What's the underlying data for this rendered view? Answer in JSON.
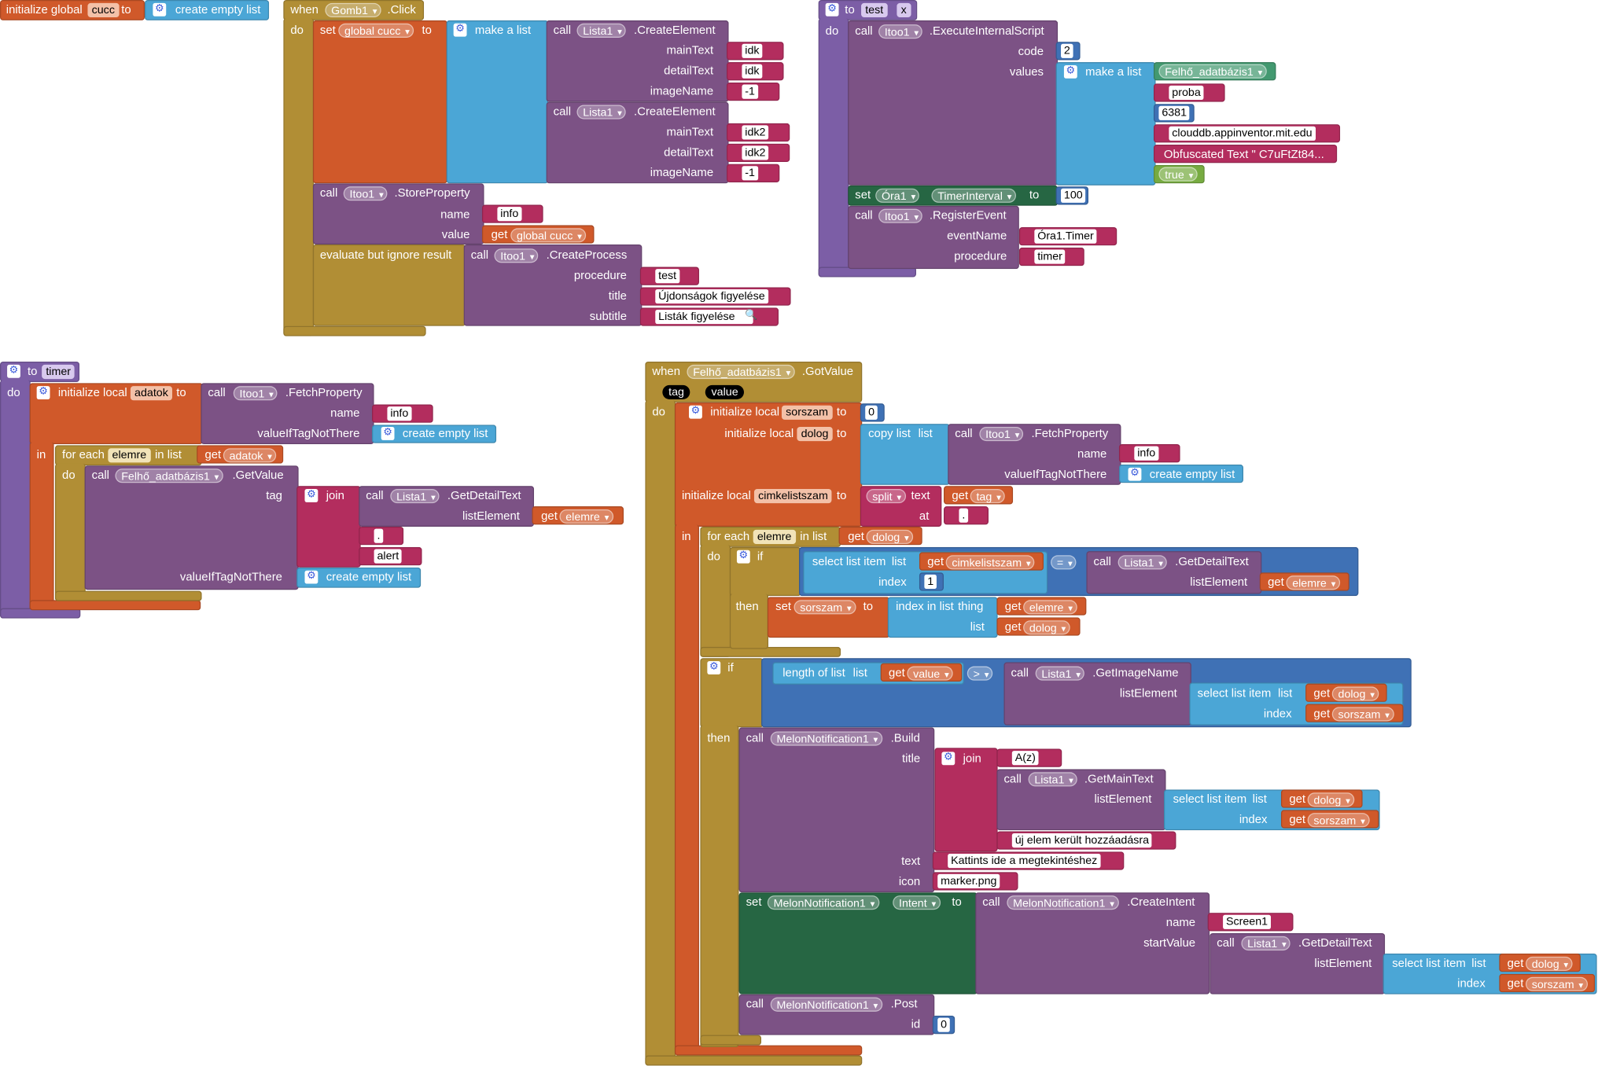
{
  "colors": {
    "variable": "#d0592a",
    "list": "#4ba6d6",
    "component": "#7c5285",
    "event": "#b18e35",
    "text": "#b32d5e",
    "math": "#3f71b5",
    "logic": "#77ab41",
    "setter": "#266643",
    "db": "#439970",
    "procedure": "#7c5ea6"
  },
  "kw": {
    "initialize_global": "initialize global",
    "initialize_local": "initialize local",
    "to": "to",
    "when": "when",
    "do": "do",
    "in": "in",
    "then": "then",
    "if": "if",
    "set": "set",
    "get": "get",
    "call": "call",
    "list": "list",
    "index": "index",
    "text": "text",
    "at": "at",
    "name": "name",
    "value": "value",
    "tag": "tag",
    "thing": "thing",
    "join": "join",
    "icon": "icon",
    "title": "title",
    "subtitle": "subtitle",
    "procedure": "procedure",
    "code": "code",
    "values": "values",
    "id": "id",
    "mainText": "mainText",
    "detailText": "detailText",
    "imageName": "imageName",
    "listElement": "listElement",
    "startValue": "startValue",
    "eventName": "eventName",
    "valueIfTagNotThere": "valueIfTagNotThere",
    "make_a_list": "make a list",
    "create_empty_list": "create empty list",
    "copy_list": "copy list",
    "select_list_item": "select list item",
    "index_in_list": "index in list",
    "length_of_list": "length of list",
    "split": "split",
    "for_each": "for each",
    "in_list": "in list",
    "evaluate_ignore": "evaluate but ignore result",
    "eq": "=",
    "gt": ">"
  },
  "names": {
    "cucc": "cucc",
    "gomb1": "Gomb1",
    "global_cucc": "global cucc",
    "lista1": "Lista1",
    "itoo1": "Itoo1",
    "felho": "Felhő_adatbázis1",
    "ora1": "Óra1",
    "melon": "MelonNotification1",
    "test": "test",
    "timer": "timer",
    "adatok": "adatok",
    "elemre": "elemre",
    "sorszam": "sorszam",
    "dolog": "dolog",
    "cimkelistszam": "cimkelistszam",
    "x": "x",
    "TimerInterval": "TimerInterval",
    "Intent": "Intent"
  },
  "methods": {
    "click": ".Click",
    "createElement": ".CreateElement",
    "storeProperty": ".StoreProperty",
    "createProcess": ".CreateProcess",
    "executeInternalScript": ".ExecuteInternalScript",
    "registerEvent": ".RegisterEvent",
    "fetchProperty": ".FetchProperty",
    "getValue": ".GetValue",
    "getDetailText": ".GetDetailText",
    "gotValue": ".GotValue",
    "getImageName": ".GetImageName",
    "build": ".Build",
    "getMainText": ".GetMainText",
    "createIntent": ".CreateIntent",
    "post": ".Post"
  },
  "strings": {
    "idk": "idk",
    "minus1": "-1",
    "idk2": "idk2",
    "info": "info",
    "test": "test",
    "ujdonsagok": "Újdonságok figyelése",
    "listak": "Listák figyelése",
    "proba": "proba",
    "num6381": "6381",
    "cloud": "clouddb.appinventor.mit.edu",
    "obf": "Obfuscated Text \" C7uFtZt84...",
    "true": "true",
    "ora1timer": "Óra1.Timer",
    "timer": "timer",
    "dot": ".",
    "alert": "alert",
    "az": "A(z)",
    "ujelem": "új elem került hozzáadásra",
    "kattints": "Kattints ide a megtekintéshez",
    "marker": "marker.png",
    "screen1": "Screen1"
  },
  "numbers": {
    "n2": "2",
    "n100": "100",
    "n0": "0",
    "n1": "1"
  }
}
